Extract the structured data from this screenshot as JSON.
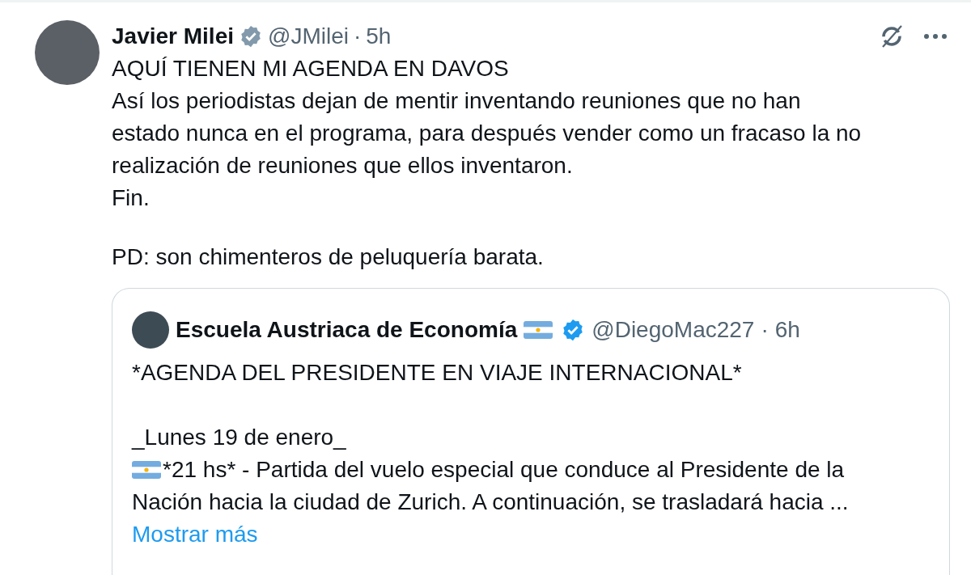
{
  "post": {
    "name": "Javier Milei",
    "verified": true,
    "color": "#829aab",
    "handle": "@JMilei",
    "separator": "·",
    "time": "5h",
    "paragraphs": [
      [
        "AQUÍ TIENEN MI AGENDA EN DAVOS",
        "Así los periodistas dejan de mentir inventando reuniones que no han",
        "estado nunca en el programa, para después vender como un fracaso la no",
        "realización de reuniones que ellos inventaron.",
        "Fin."
      ],
      [
        "PD: son chimenteros de peluquería barata."
      ]
    ]
  },
  "quote": {
    "name": "Escuela Austriaca de Economía",
    "name_flag": true,
    "verified": true,
    "color": "#1d9bf0",
    "handle": "@DiegoMac227",
    "separator": "·",
    "time": "6h",
    "paragraphs": [
      [
        {
          "text": "*AGENDA DEL PRESIDENTE EN VIAJE INTERNACIONAL*",
          "flag": false
        }
      ],
      [
        {
          "text": "_Lunes 19 de enero_",
          "flag": false
        },
        {
          "text": "*21 hs* - Partida del vuelo especial que conduce al Presidente de la",
          "flag": true
        },
        {
          "text": "Nación hacia la ciudad de Zurich. A continuación, se trasladará hacia ...",
          "flag": false
        }
      ]
    ],
    "show_more": "Mostrar más"
  }
}
